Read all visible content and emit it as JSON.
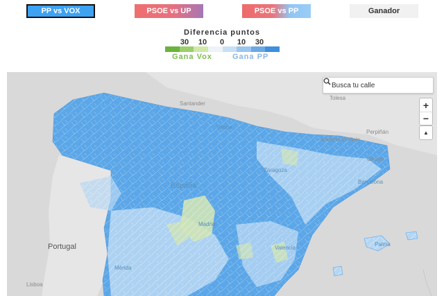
{
  "buttons": {
    "pp_vox": "PP vs VOX",
    "psoe_up": "PSOE vs UP",
    "psoe_pp": "PSOE vs PP",
    "winner": "Ganador"
  },
  "legend": {
    "title": "Diferencia puntos",
    "ticks": [
      "30",
      "10",
      "0",
      "10",
      "30"
    ],
    "left_label": "Gana Vox",
    "right_label": "Gana PP",
    "colors": [
      "#6bb33d",
      "#9cce6a",
      "#cfe8a8",
      "#eef3f8",
      "#c9e0f4",
      "#9bc6ee",
      "#6aa9e5",
      "#3f8fdc"
    ],
    "vox_color": "#7cbd4f",
    "pp_color": "#8ab6e3"
  },
  "map": {
    "search_placeholder": "Busca tu calle",
    "zoom_in": "+",
    "zoom_out": "−",
    "reset_north": "▲",
    "places": {
      "santander": "Santander",
      "toulouse": "Tolesa",
      "vitoria": "Vitoria",
      "perpinan": "Perpiñán",
      "andorra": "Andorra la Vieja",
      "girona": "Girona",
      "zaragoza": "Zaragoza",
      "barcelona": "Barcelona",
      "espana": "España",
      "madrid": "Madrid",
      "valencia": "Valencia",
      "portugal": "Portugal",
      "merida": "Mérida",
      "lisboa": "Lisboa",
      "palma": "Palma"
    }
  }
}
